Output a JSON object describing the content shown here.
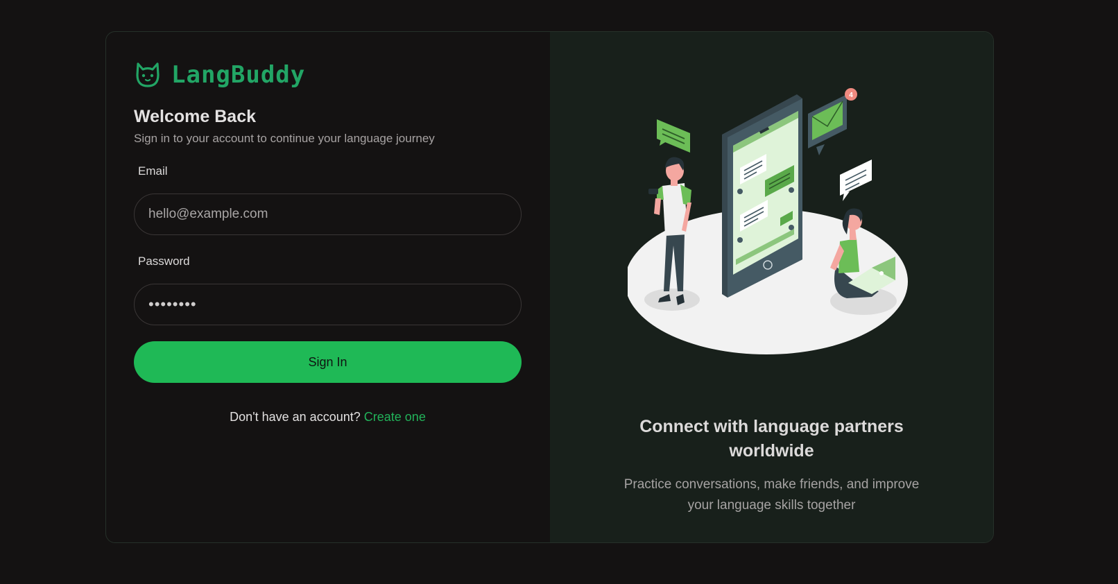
{
  "brand": {
    "name": "LangBuddy",
    "logo_icon": "cat-face-icon",
    "accent_color": "#22a565"
  },
  "login": {
    "title": "Welcome Back",
    "subtitle": "Sign in to your account to continue your language journey",
    "email_label": "Email",
    "email_placeholder": "hello@example.com",
    "password_label": "Password",
    "password_value": "••••••••",
    "signin_label": "Sign In",
    "signin_color": "#1fb956",
    "signup_prompt": "Don't have an account?",
    "signup_link": "Create one"
  },
  "promo": {
    "illustration": "chat-app-illustration",
    "notification_count": "4",
    "title": "Connect with language partners worldwide",
    "text": "Practice conversations, make friends, and improve your language skills together"
  }
}
